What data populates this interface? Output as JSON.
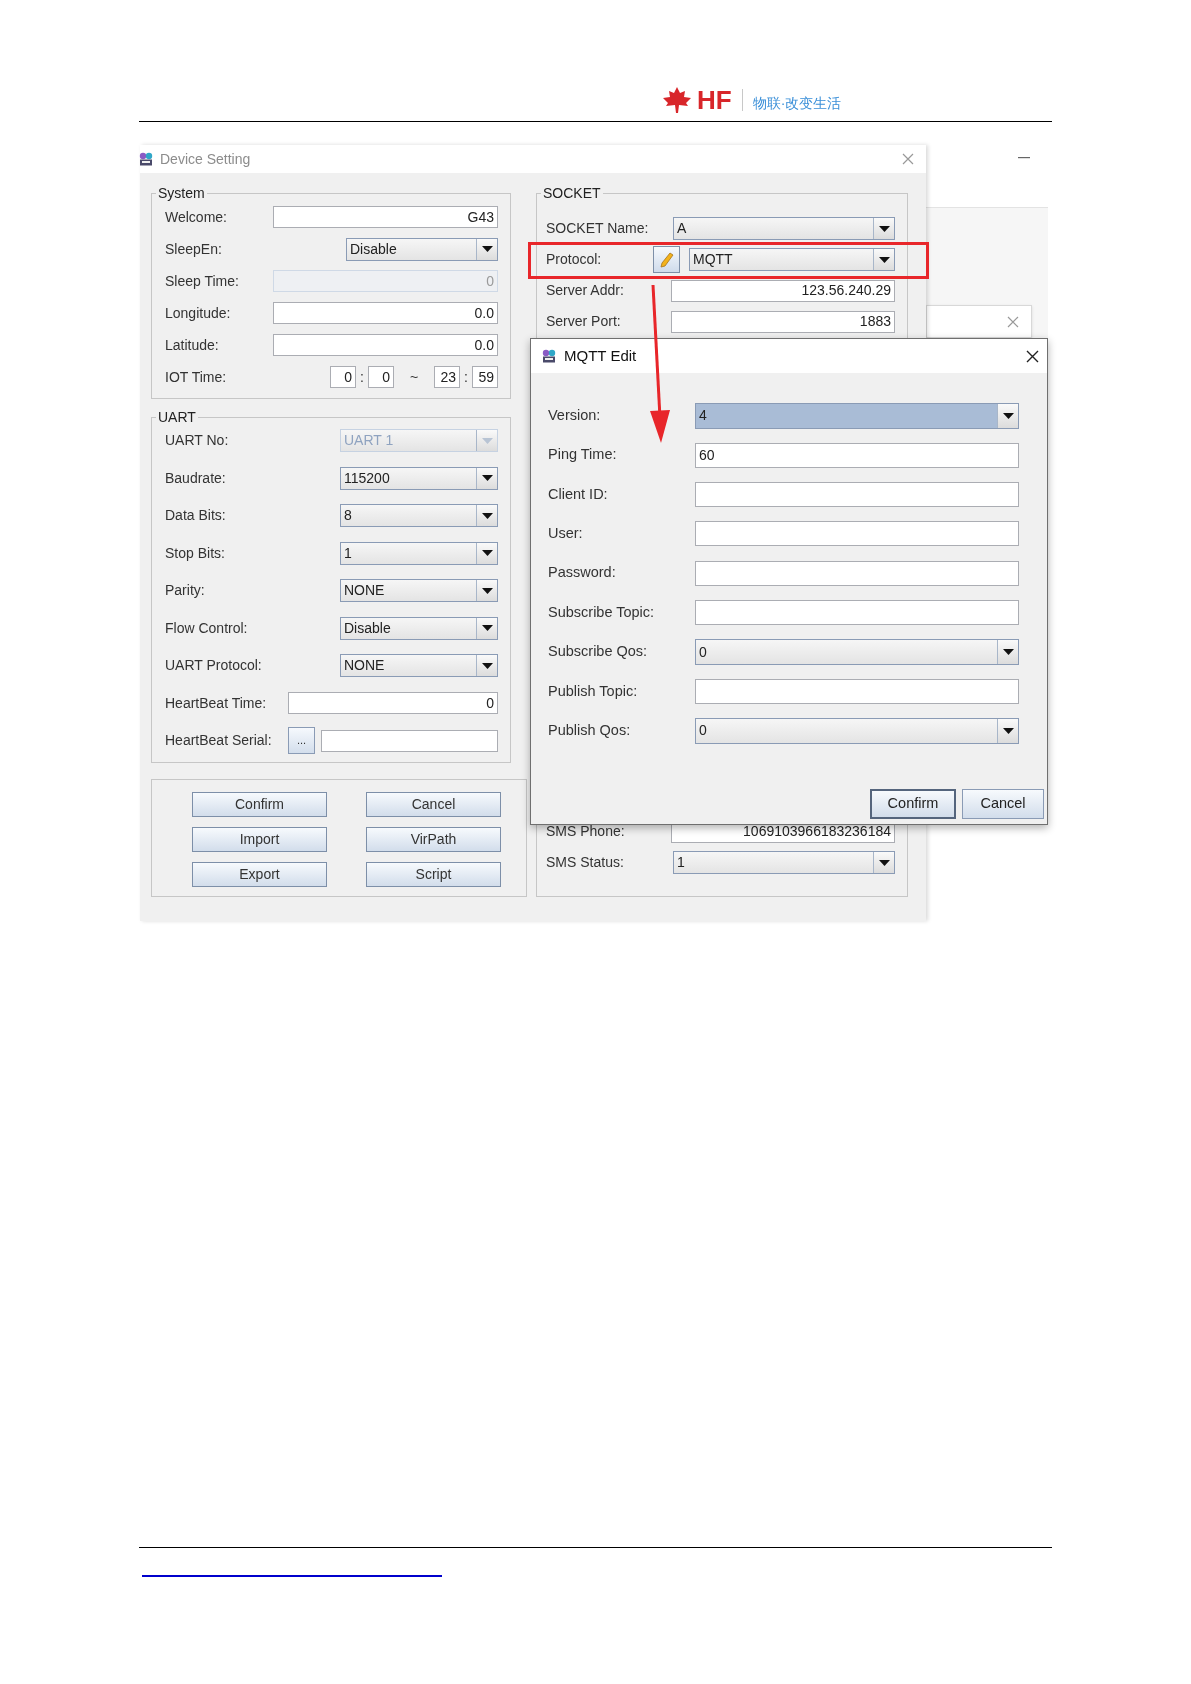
{
  "header": {
    "brand": "HF",
    "slogan": "物联·改变生活"
  },
  "device_setting": {
    "title": "Device Setting",
    "system": {
      "legend": "System",
      "rows": [
        {
          "kind": "text",
          "label": "Welcome:",
          "value": "G43",
          "disabled": false
        },
        {
          "kind": "combo",
          "label": "SleepEn:",
          "value": "Disable",
          "disabled": false
        },
        {
          "kind": "text",
          "label": "Sleep Time:",
          "value": "0",
          "disabled": true
        },
        {
          "kind": "text",
          "label": "Longitude:",
          "value": "0.0",
          "disabled": false
        },
        {
          "kind": "text",
          "label": "Latitude:",
          "value": "0.0",
          "disabled": false
        },
        {
          "kind": "time",
          "label": "IOT Time:",
          "values": [
            "0",
            "0",
            "23",
            "59"
          ],
          "separators": [
            ":",
            "~",
            ":"
          ],
          "disabled": false
        }
      ]
    },
    "uart": {
      "legend": "UART",
      "rows": [
        {
          "kind": "combo",
          "label": "UART No:",
          "value": "UART 1",
          "disabled": true
        },
        {
          "kind": "combo",
          "label": "Baudrate:",
          "value": "115200",
          "disabled": false
        },
        {
          "kind": "combo",
          "label": "Data Bits:",
          "value": "8",
          "disabled": false
        },
        {
          "kind": "combo",
          "label": "Stop Bits:",
          "value": "1",
          "disabled": false
        },
        {
          "kind": "combo",
          "label": "Parity:",
          "value": "NONE",
          "disabled": false
        },
        {
          "kind": "combo",
          "label": "Flow Control:",
          "value": "Disable",
          "disabled": false
        },
        {
          "kind": "combo",
          "label": "UART Protocol:",
          "value": "NONE",
          "disabled": false
        },
        {
          "kind": "text",
          "label": "HeartBeat Time:",
          "value": "0",
          "disabled": false
        },
        {
          "kind": "serial",
          "label": "HeartBeat Serial:",
          "button": "...",
          "disabled": false
        }
      ]
    },
    "buttons": [
      "Confirm",
      "Cancel",
      "Import",
      "VirPath",
      "Export",
      "Script"
    ],
    "socket": {
      "legend": "SOCKET",
      "rows": [
        {
          "kind": "combo",
          "label": "SOCKET Name:",
          "value": "A"
        },
        {
          "kind": "protocol",
          "label": "Protocol:",
          "value": "MQTT",
          "highlighted": true
        },
        {
          "kind": "text",
          "label": "Server Addr:",
          "value": "123.56.240.29"
        },
        {
          "kind": "text",
          "label": "Server Port:",
          "value": "1883"
        }
      ],
      "bottom_rows": [
        {
          "kind": "text",
          "label": "SMS Phone:",
          "value": "1069103966183236184"
        },
        {
          "kind": "combo",
          "label": "SMS Status:",
          "value": "1"
        }
      ]
    }
  },
  "mqtt_edit": {
    "title": "MQTT Edit",
    "rows": [
      {
        "kind": "combo",
        "label": "Version:",
        "value": "4",
        "focused": true
      },
      {
        "kind": "text",
        "label": "Ping Time:",
        "value": "60",
        "focused": false
      },
      {
        "kind": "text",
        "label": "Client ID:",
        "focused": false
      },
      {
        "kind": "text",
        "label": "User:",
        "focused": false
      },
      {
        "kind": "text",
        "label": "Password:",
        "focused": false
      },
      {
        "kind": "text",
        "label": "Subscribe Topic:",
        "focused": false
      },
      {
        "kind": "combo",
        "label": "Subscribe Qos:",
        "value": "0",
        "focused": false
      },
      {
        "kind": "text",
        "label": "Publish Topic:",
        "focused": false
      },
      {
        "kind": "combo",
        "label": "Publish Qos:",
        "value": "0",
        "focused": false
      }
    ],
    "buttons": [
      "Confirm",
      "Cancel"
    ]
  }
}
